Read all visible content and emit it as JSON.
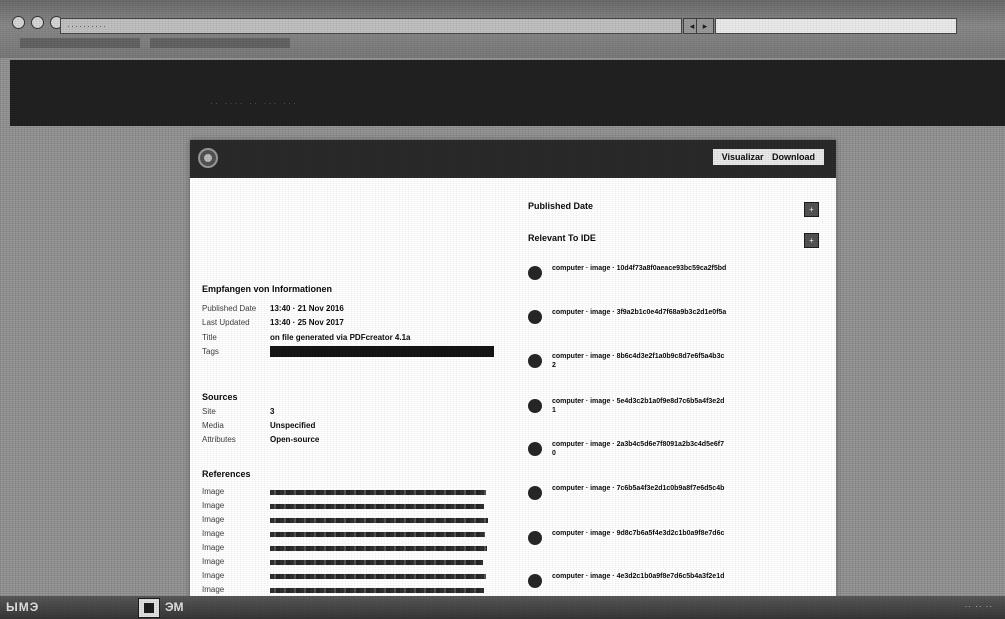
{
  "browser": {
    "url_text": "··········",
    "back_glyph": "◂",
    "forward_glyph": "▸",
    "search_text": ""
  },
  "bookmarks_bar": {
    "text": "·· ···· ·· ··· ···"
  },
  "panel": {
    "header_actions": {
      "view_label": "Visualizar",
      "download_label": "Download"
    },
    "left": {
      "section_general": {
        "title": "Empfangen von Informationen",
        "rows": [
          {
            "key": "Published Date",
            "value": "13:40 · 21 Nov 2016"
          },
          {
            "key": "Last Updated",
            "value": "13:40 · 25 Nov 2017"
          },
          {
            "key": "Title",
            "value": "on file generated via PDFcreator 4.1a"
          },
          {
            "key": "Tags",
            "value": ""
          }
        ]
      },
      "section_sources": {
        "title": "Sources",
        "rows": [
          {
            "key": "Site",
            "value": "3"
          },
          {
            "key": "Media",
            "value": "Unspecified"
          },
          {
            "key": "Attributes",
            "value": "Open-source"
          }
        ]
      },
      "section_refs": {
        "title": "References",
        "rows": [
          {
            "key": "Image"
          },
          {
            "key": "Image"
          },
          {
            "key": "Image"
          },
          {
            "key": "Image"
          },
          {
            "key": "Image"
          },
          {
            "key": "Image"
          },
          {
            "key": "Image"
          },
          {
            "key": "Image"
          }
        ]
      }
    },
    "right": {
      "label_a": "Published Date",
      "label_b": "Relevant To IDE",
      "button_a": "+",
      "button_b": "+",
      "messages": [
        {
          "text": "computer · image · 10d4f73a8f0aeace93bc59ca2f5bd"
        },
        {
          "text": "computer · image · 3f9a2b1c0e4d7f68a9b3c2d1e0f5a"
        },
        {
          "text": "computer · image · 8b6c4d3e2f1a0b9c8d7e6f5a4b3c2"
        },
        {
          "text": "computer · image · 5e4d3c2b1a0f9e8d7c6b5a4f3e2d1"
        },
        {
          "text": "computer · image · 2a3b4c5d6e7f8091a2b3c4d5e6f70"
        },
        {
          "text": "computer · image · 7c6b5a4f3e2d1c0b9a8f7e6d5c4b"
        },
        {
          "text": "computer · image · 9d8c7b6a5f4e3d2c1b0a9f8e7d6c"
        },
        {
          "text": "computer · image · 4e3d2c1b0a9f8e7d6c5b4a3f2e1d"
        }
      ]
    }
  },
  "taskbar": {
    "start_label": "ЫМЭ",
    "app_label": "ЭМ",
    "tray_text": "·· ·· ··"
  }
}
